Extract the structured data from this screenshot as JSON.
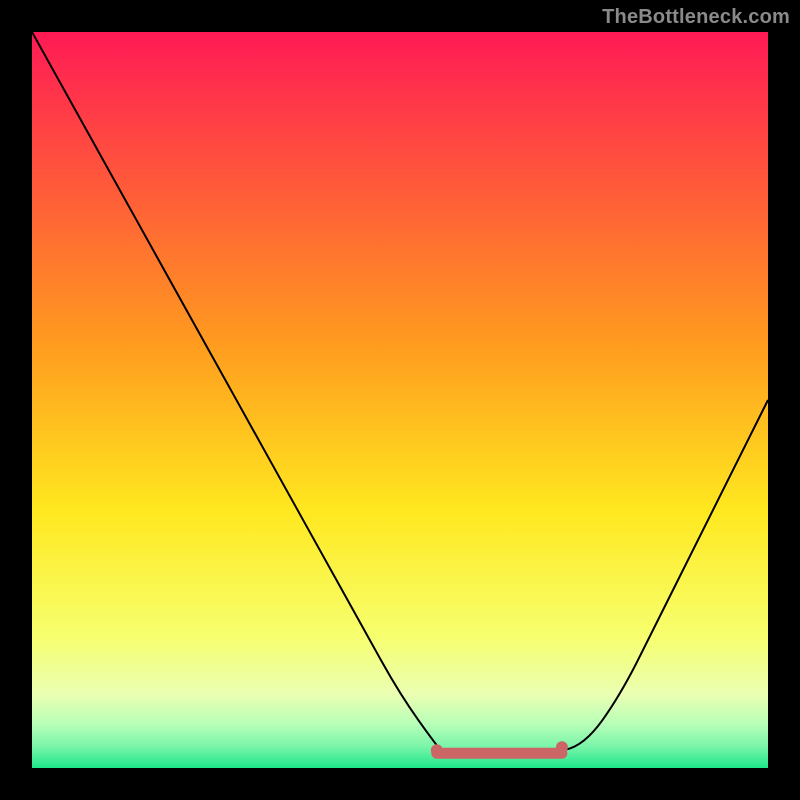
{
  "watermark": "TheBottleneck.com",
  "chart_data": {
    "type": "line",
    "title": "",
    "xlabel": "",
    "ylabel": "",
    "xlim": [
      0,
      100
    ],
    "ylim": [
      0,
      100
    ],
    "x": [
      0,
      5,
      10,
      15,
      20,
      25,
      30,
      35,
      40,
      45,
      50,
      55,
      56,
      60,
      65,
      70,
      75,
      80,
      85,
      90,
      95,
      100
    ],
    "values": [
      100,
      91,
      82,
      73,
      64,
      55,
      46,
      37,
      28,
      19,
      10,
      3,
      2,
      2,
      2,
      2,
      3,
      10,
      20,
      30,
      40,
      50
    ],
    "annotations": [
      {
        "type": "marker-band",
        "x_start": 55,
        "x_end": 72,
        "y": 2,
        "color": "#cc6666"
      }
    ],
    "background_gradient": {
      "stops": [
        {
          "pos": 0.0,
          "color": "#ff1a55"
        },
        {
          "pos": 0.42,
          "color": "#ff9a1f"
        },
        {
          "pos": 0.65,
          "color": "#ffe81f"
        },
        {
          "pos": 0.82,
          "color": "#f7ff6e"
        },
        {
          "pos": 0.9,
          "color": "#eaffb2"
        },
        {
          "pos": 0.94,
          "color": "#b8ffb8"
        },
        {
          "pos": 0.97,
          "color": "#7cf5aa"
        },
        {
          "pos": 1.0,
          "color": "#1ee68b"
        }
      ]
    }
  }
}
